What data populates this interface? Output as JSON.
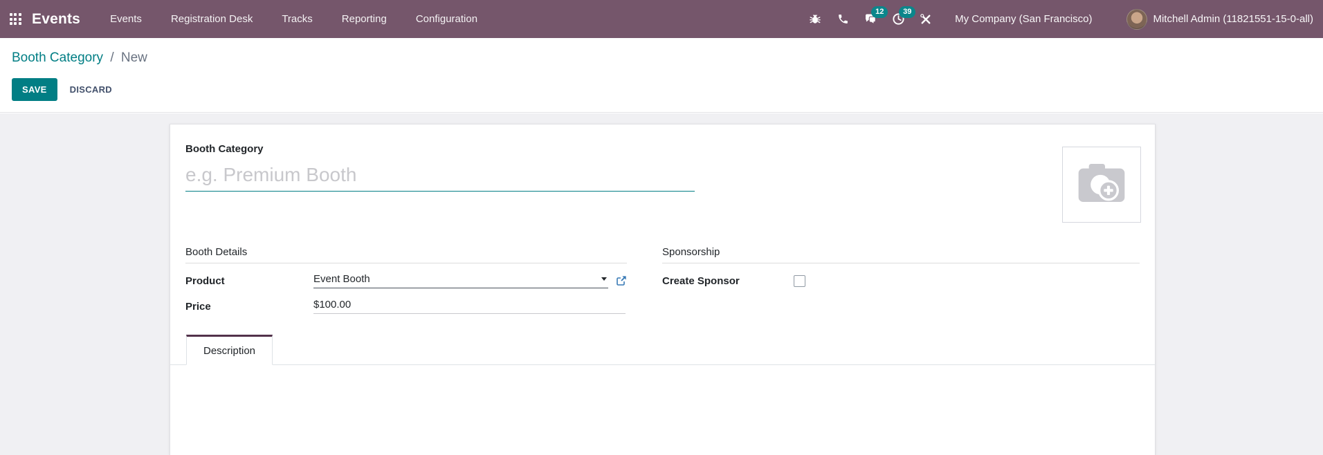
{
  "nav": {
    "app_name": "Events",
    "menu": [
      "Events",
      "Registration Desk",
      "Tracks",
      "Reporting",
      "Configuration"
    ],
    "icons": [
      "apps-grid-icon",
      "bug-icon",
      "phone-icon",
      "messages-icon",
      "activity-clock-icon",
      "tools-icon"
    ],
    "badges": {
      "messages": "12",
      "activities": "39"
    },
    "company": "My Company (San Francisco)",
    "user": "Mitchell Admin (11821551-15-0-all)"
  },
  "breadcrumb": {
    "parent": "Booth Category",
    "separator": "/",
    "current": "New"
  },
  "actions": {
    "save": "SAVE",
    "discard": "DISCARD"
  },
  "form": {
    "title_label": "Booth Category",
    "title_placeholder": "e.g. Premium Booth",
    "image_placeholder_icon": "camera-add-icon",
    "booth_details": {
      "title": "Booth Details",
      "product_label": "Product",
      "product_value": "Event Booth",
      "price_label": "Price",
      "price_value": "$100.00"
    },
    "sponsorship": {
      "title": "Sponsorship",
      "create_sponsor_label": "Create Sponsor",
      "create_sponsor_checked": false
    },
    "tabs": [
      {
        "label": "Description",
        "active": true
      }
    ]
  },
  "colors": {
    "navbar_bg": "#75566B",
    "accent_teal": "#017E84",
    "badge_bg": "#0B868B",
    "page_bg": "#F0F0F3",
    "tab_active_border": "#52314A",
    "link_blue": "#3779B5"
  }
}
